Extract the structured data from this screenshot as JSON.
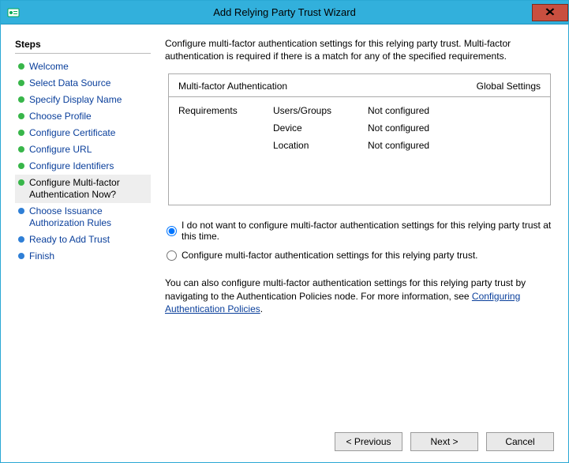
{
  "window": {
    "title": "Add Relying Party Trust Wizard"
  },
  "steps": {
    "heading": "Steps",
    "items": [
      {
        "label": "Welcome",
        "status": "done",
        "active": false
      },
      {
        "label": "Select Data Source",
        "status": "done",
        "active": false
      },
      {
        "label": "Specify Display Name",
        "status": "done",
        "active": false
      },
      {
        "label": "Choose Profile",
        "status": "done",
        "active": false
      },
      {
        "label": "Configure Certificate",
        "status": "done",
        "active": false
      },
      {
        "label": "Configure URL",
        "status": "done",
        "active": false
      },
      {
        "label": "Configure Identifiers",
        "status": "done",
        "active": false
      },
      {
        "label": "Configure Multi-factor Authentication Now?",
        "status": "done",
        "active": true
      },
      {
        "label": "Choose Issuance Authorization Rules",
        "status": "pending",
        "active": false
      },
      {
        "label": "Ready to Add Trust",
        "status": "pending",
        "active": false
      },
      {
        "label": "Finish",
        "status": "pending",
        "active": false
      }
    ]
  },
  "main": {
    "intro": "Configure multi-factor authentication settings for this relying party trust. Multi-factor authentication is required if there is a match for any of the specified requirements.",
    "mfa_box": {
      "left_header": "Multi-factor Authentication",
      "right_header": "Global Settings",
      "row_label": "Requirements",
      "rows": [
        {
          "name": "Users/Groups",
          "value": "Not configured"
        },
        {
          "name": "Device",
          "value": "Not configured"
        },
        {
          "name": "Location",
          "value": "Not configured"
        }
      ]
    },
    "radio_no": "I do not want to configure multi-factor authentication settings for this relying party trust at this time.",
    "radio_yes": "Configure multi-factor authentication settings for this relying party trust.",
    "radio_selected": "no",
    "footnote_a": "You can also configure multi-factor authentication settings for this relying party trust by navigating to the Authentication Policies node. For more information, see ",
    "footnote_link": "Configuring Authentication Policies",
    "footnote_b": "."
  },
  "buttons": {
    "previous": "< Previous",
    "next": "Next >",
    "cancel": "Cancel"
  }
}
